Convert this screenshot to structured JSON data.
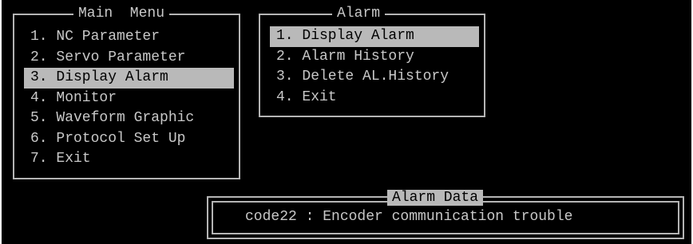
{
  "colors": {
    "background": "#000000",
    "text": "#c8c8c8",
    "highlight_bg": "#b9b9b9",
    "highlight_text": "#000000",
    "border": "#b4b4b4"
  },
  "main_menu": {
    "title": "Main  Menu",
    "items": [
      {
        "label": "1. NC Parameter",
        "selected": false
      },
      {
        "label": "2. Servo Parameter",
        "selected": false
      },
      {
        "label": "3. Display Alarm",
        "selected": true
      },
      {
        "label": "4. Monitor",
        "selected": false
      },
      {
        "label": "5. Waveform Graphic",
        "selected": false
      },
      {
        "label": "6. Protocol Set Up",
        "selected": false
      },
      {
        "label": "7. Exit",
        "selected": false
      }
    ]
  },
  "alarm_menu": {
    "title": "Alarm",
    "items": [
      {
        "label": "1. Display Alarm",
        "selected": true
      },
      {
        "label": "2. Alarm History",
        "selected": false
      },
      {
        "label": "3. Delete AL.History",
        "selected": false
      },
      {
        "label": "4. Exit",
        "selected": false
      }
    ]
  },
  "alarm_data": {
    "title": "Alarm Data",
    "text": "code22 : Encoder communication trouble"
  }
}
